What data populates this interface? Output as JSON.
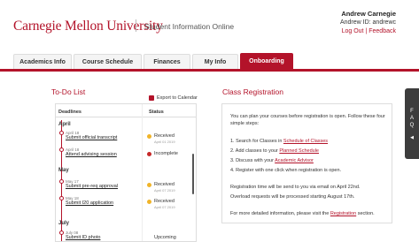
{
  "header": {
    "logo_text": "Carnegie Mellon University",
    "app_title": "Student Information Online",
    "user_name": "Andrew Carnegie",
    "user_id": "Andrew ID:  andrewc",
    "logout_label": "Log Out",
    "feedback_label": "Feedback",
    "separator": "|"
  },
  "nav": {
    "tabs": [
      {
        "label": "Academics Info",
        "active": false
      },
      {
        "label": "Course Schedule",
        "active": false
      },
      {
        "label": "Finances",
        "active": false
      },
      {
        "label": "My Info",
        "active": false
      },
      {
        "label": "Onboarding",
        "active": true
      }
    ],
    "accent": "#b3132a"
  },
  "todo": {
    "title": "To-Do List",
    "export_label": "Export to Calendar",
    "col_deadlines": "Deadlines",
    "col_status": "Status",
    "months": [
      {
        "name": "April",
        "items": [
          {
            "due": "April 18",
            "task": "Submit official transcript",
            "status": "Received",
            "status_date": "April 01 2019",
            "status_color": "#f0b429"
          },
          {
            "due": "April 18",
            "task": "Attend advising session",
            "status": "Incomplete",
            "status_date": "",
            "status_color": "#c62828"
          }
        ]
      },
      {
        "name": "May",
        "items": [
          {
            "due": "May 17",
            "task": "Submit pre-req approval",
            "status": "Received",
            "status_date": "April 07 2019",
            "status_color": "#f0b429"
          },
          {
            "due": "May 18",
            "task": "Submit I20 application",
            "status": "Received",
            "status_date": "April 07 2019",
            "status_color": "#f0b429"
          }
        ]
      },
      {
        "name": "July",
        "items": [
          {
            "due": "July 08",
            "task": "Submit ID photo",
            "status": "Upcoming",
            "status_date": "",
            "status_color": ""
          }
        ]
      }
    ]
  },
  "registration": {
    "title": "Class Registration",
    "intro": "You can plan your courses before registration is open. Follow these four simple steps:",
    "steps": [
      {
        "pre": "1. Search for Classes in ",
        "link": "Schedule of Classes",
        "post": ""
      },
      {
        "pre": "2. Add classes to your ",
        "link": "Planned Schedule",
        "post": ""
      },
      {
        "pre": "3. Discuss with your ",
        "link": "Academic Advisor",
        "post": ""
      },
      {
        "pre": "4. Register with one click when registration is open.",
        "link": "",
        "post": ""
      }
    ],
    "email_note": "Registration time will be send to you via email on April 22nd.",
    "overload_note": "Overload requests will be processed starting August 17th.",
    "more_pre": "For more detailed information, please visit the ",
    "more_link": "Registration",
    "more_post": " section."
  },
  "faq": {
    "letters": [
      "F",
      "A",
      "Q"
    ],
    "arrow": "◀"
  }
}
